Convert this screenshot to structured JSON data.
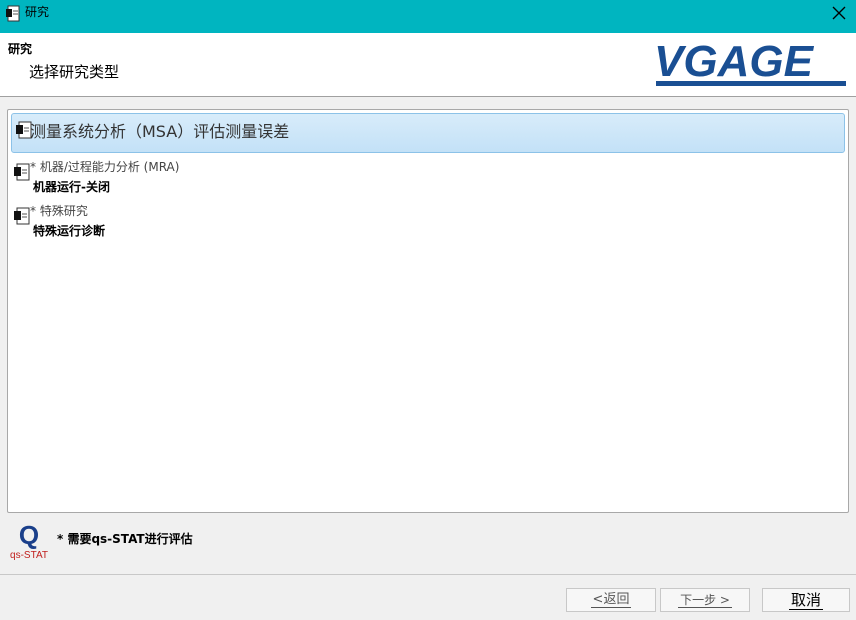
{
  "window": {
    "title": "研究"
  },
  "header": {
    "title": "研究",
    "subtitle": "选择研究类型",
    "logo_text": "VGAGE"
  },
  "study_types": [
    {
      "label": "测量系统分析（MSA）评估测量误差",
      "sub": ""
    },
    {
      "label": "* 机器/过程能力分析 (MRA)",
      "sub": "机器运行-关闭"
    },
    {
      "label": "* 特殊研究",
      "sub": "特殊运行诊断"
    }
  ],
  "qs_stat": {
    "logo_letter": "Q",
    "logo_text": "qs-STAT",
    "note": "* 需要qs-STAT进行评估"
  },
  "buttons": {
    "back": "<返回",
    "next": "下一步 >",
    "cancel": "取消"
  },
  "colors": {
    "titlebar": "#00b5c0",
    "logo_blue": "#1a4f93",
    "selection": "#c8e4f8"
  }
}
